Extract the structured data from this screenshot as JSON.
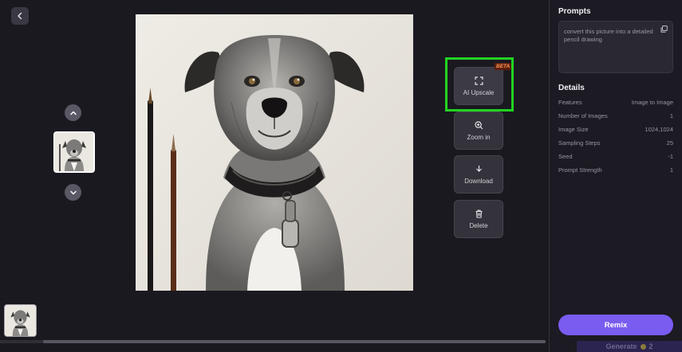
{
  "viewer": {
    "back_icon": "chevron-left-icon",
    "prev_icon": "chevron-up-icon",
    "next_icon": "chevron-down-icon",
    "actions": [
      {
        "label": "AI Upscale",
        "icon": "expand-icon",
        "badge": "BETA",
        "highlighted": true
      },
      {
        "label": "Zoom in",
        "icon": "zoom-in-icon"
      },
      {
        "label": "Download",
        "icon": "download-icon"
      },
      {
        "label": "Delete",
        "icon": "trash-icon"
      }
    ]
  },
  "side": {
    "prompts_title": "Prompts",
    "prompt_text": "convert this picture into a detailed pencil drawing",
    "details_title": "Details",
    "details": [
      {
        "label": "Features",
        "value": "Image to Image"
      },
      {
        "label": "Number of Images",
        "value": "1"
      },
      {
        "label": "Image Size",
        "value": "1024,1024"
      },
      {
        "label": "Sampling Steps",
        "value": "25"
      },
      {
        "label": "Seed",
        "value": "-1"
      },
      {
        "label": "Prompt Strength",
        "value": "1"
      }
    ],
    "remix_label": "Remix",
    "generate_label": "Generate",
    "generate_cost": "2"
  },
  "colors": {
    "accent": "#7a5cf0",
    "highlight": "#22d422",
    "beta_text": "#ff9a5a"
  }
}
